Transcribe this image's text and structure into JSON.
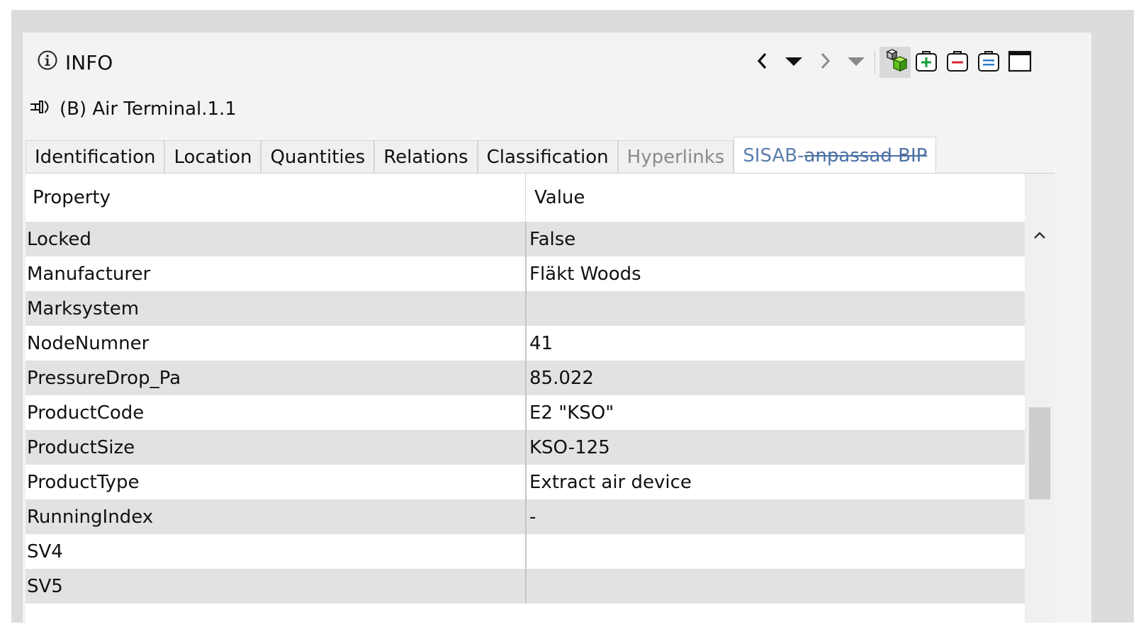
{
  "header": {
    "title": "INFO"
  },
  "toolbar": {
    "buttons": [
      {
        "icon": "back-chevron-icon"
      },
      {
        "icon": "back-history-dropdown-icon"
      },
      {
        "icon": "forward-chevron-icon"
      },
      {
        "icon": "forward-history-dropdown-icon"
      },
      {
        "icon": "select-in-model-icon"
      },
      {
        "icon": "add-property-icon"
      },
      {
        "icon": "remove-property-icon"
      },
      {
        "icon": "edit-property-icon"
      },
      {
        "icon": "maximize-window-icon"
      }
    ]
  },
  "object": {
    "icon": "air-terminal-icon",
    "name": "(B) Air Terminal.1.1"
  },
  "tabs": [
    {
      "label": "Identification"
    },
    {
      "label": "Location"
    },
    {
      "label": "Quantities"
    },
    {
      "label": "Relations"
    },
    {
      "label": "Classification"
    },
    {
      "label": "Hyperlinks",
      "state": "disabled"
    },
    {
      "label_prefix": "SISAB-",
      "label_strike": "anpassad BIP",
      "state": "active"
    }
  ],
  "table": {
    "columns": [
      "Property",
      "Value"
    ],
    "rows": [
      {
        "property": "Locked",
        "value": "False"
      },
      {
        "property": "Manufacturer",
        "value": "Fläkt Woods"
      },
      {
        "property": "Marksystem",
        "value": ""
      },
      {
        "property": "NodeNumner",
        "value": "41"
      },
      {
        "property": "PressureDrop_Pa",
        "value": "85.022"
      },
      {
        "property": "ProductCode",
        "value": "E2 \"KSO\""
      },
      {
        "property": "ProductSize",
        "value": "KSO-125"
      },
      {
        "property": "ProductType",
        "value": "Extract air device"
      },
      {
        "property": "RunningIndex",
        "value": "-"
      },
      {
        "property": "SV4",
        "value": ""
      },
      {
        "property": "SV5",
        "value": ""
      }
    ]
  },
  "colors": {
    "active_tab_text": "#5b7fae",
    "row_alt": "#e2e2e2",
    "add_green": "#1a9e3a",
    "remove_red": "#d9262b",
    "edit_blue": "#2f7fc9"
  }
}
